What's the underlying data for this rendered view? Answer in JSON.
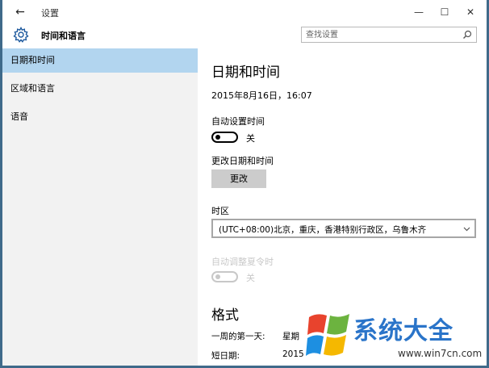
{
  "titlebar": {
    "back_glyph": "←",
    "title": "设置",
    "minimize_glyph": "—",
    "maximize_glyph": "☐",
    "close_glyph": "✕"
  },
  "header": {
    "icon": "gear-icon",
    "title": "时间和语言",
    "search_placeholder": "查找设置",
    "search_icon": "search-icon"
  },
  "sidebar": {
    "items": [
      {
        "label": "日期和时间",
        "active": true
      },
      {
        "label": "区域和语言",
        "active": false
      },
      {
        "label": "语音",
        "active": false
      }
    ]
  },
  "main": {
    "title": "日期和时间",
    "datetime": "2015年8月16日，16:07",
    "auto_time": {
      "label": "自动设置时间",
      "state": "关"
    },
    "change_date_time": {
      "label": "更改日期和时间",
      "button": "更改"
    },
    "timezone": {
      "label": "时区",
      "value": "(UTC+08:00)北京，重庆，香港特别行政区，乌鲁木齐"
    },
    "auto_dst": {
      "label": "自动调整夏令时",
      "state": "关"
    },
    "formats": {
      "title": "格式",
      "first_day_label": "一周的第一天:",
      "first_day_value": "星期",
      "short_date_label": "短日期:",
      "short_date_value": "2015"
    }
  },
  "watermark": {
    "text": "系统大全",
    "url": "www.win7cn.com"
  },
  "colors": {
    "sidebar_bg": "#f2f2f2",
    "sidebar_active": "#b2d5ef",
    "button_bg": "#cccccc",
    "watermark_blue": "#2a74c9"
  }
}
